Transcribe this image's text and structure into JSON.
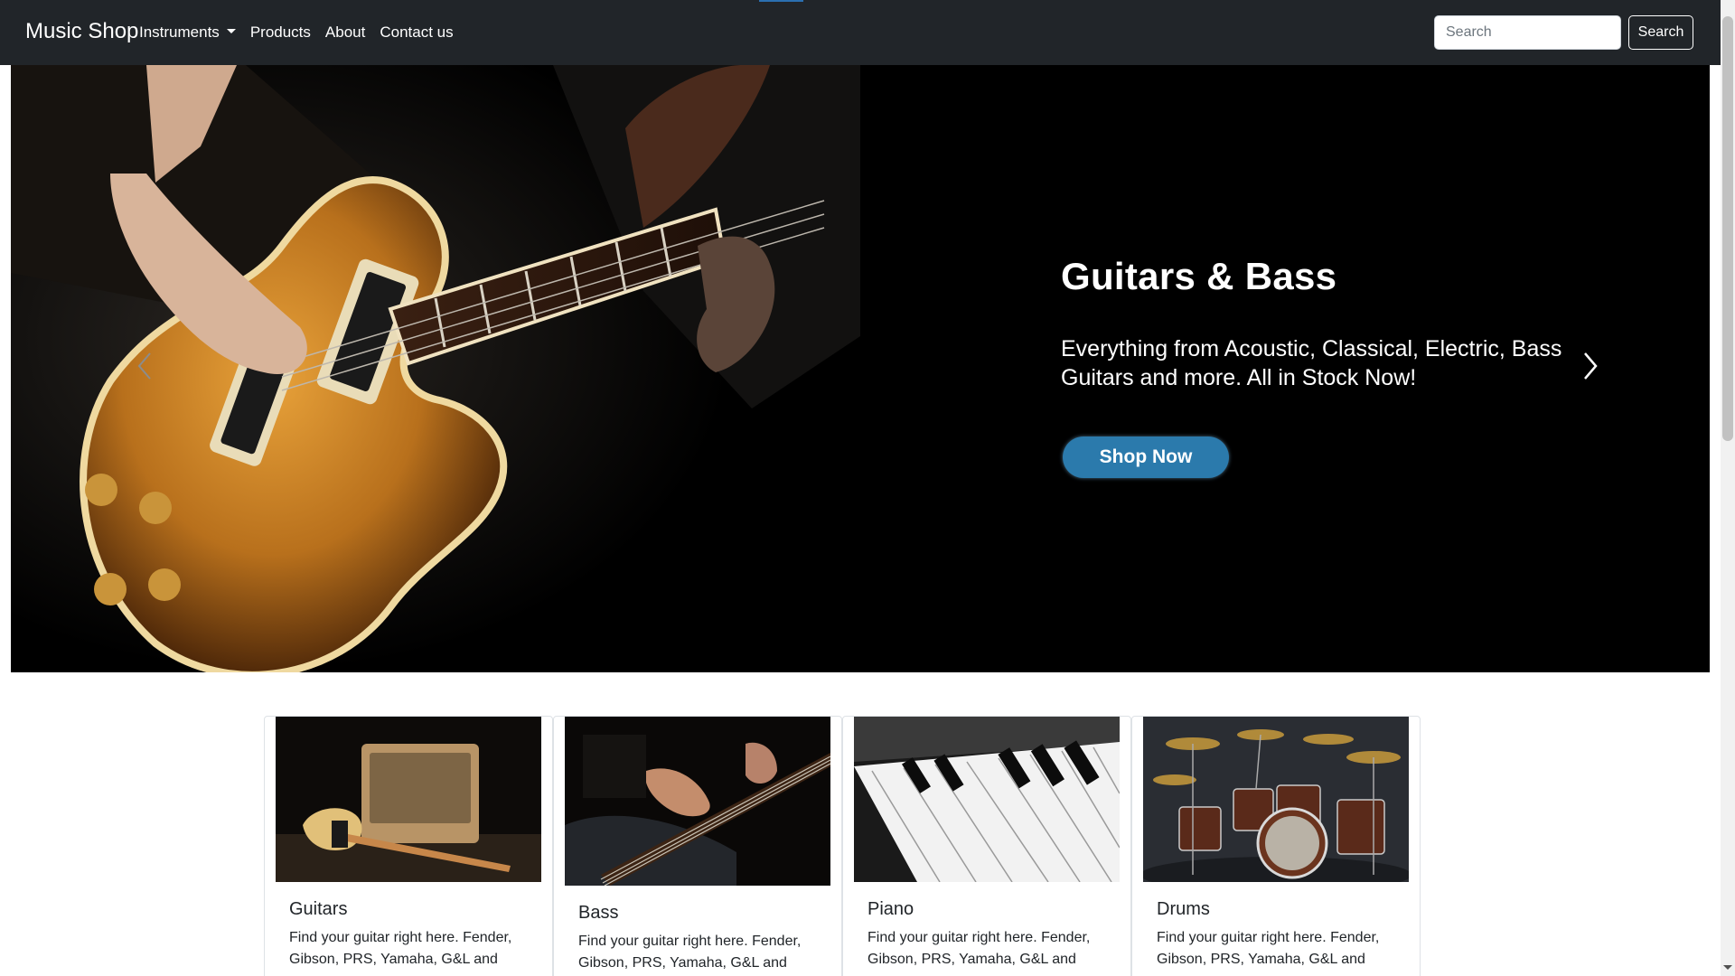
{
  "navbar": {
    "brand": "Music Shop",
    "links": [
      "Instruments",
      "Products",
      "About",
      "Contact us"
    ],
    "search_placeholder": "Search",
    "search_button": "Search"
  },
  "carousel": {
    "title": "Guitars & Bass",
    "text": "Everything from Acoustic, Classical, Electric, Bass Guitars and more. All in Stock Now!",
    "button": "Shop Now"
  },
  "cards": [
    {
      "title": "Guitars",
      "text": "Find your guitar right here. Fender, Gibson, PRS, Yamaha, G&L and"
    },
    {
      "title": "Bass",
      "text": "Find your guitar right here. Fender, Gibson, PRS, Yamaha, G&L and"
    },
    {
      "title": "Piano",
      "text": "Find your guitar right here. Fender, Gibson, PRS, Yamaha, G&L and"
    },
    {
      "title": "Drums",
      "text": "Find your guitar right here. Fender, Gibson, PRS, Yamaha, G&L and"
    }
  ],
  "colors": {
    "navbar_bg": "#212529",
    "accent_button": "#2b7aac",
    "guitar_body": "#b8701c"
  },
  "icons": {
    "prev": "chevron-left-icon",
    "next": "chevron-right-icon",
    "dropdown": "caret-down-icon"
  }
}
